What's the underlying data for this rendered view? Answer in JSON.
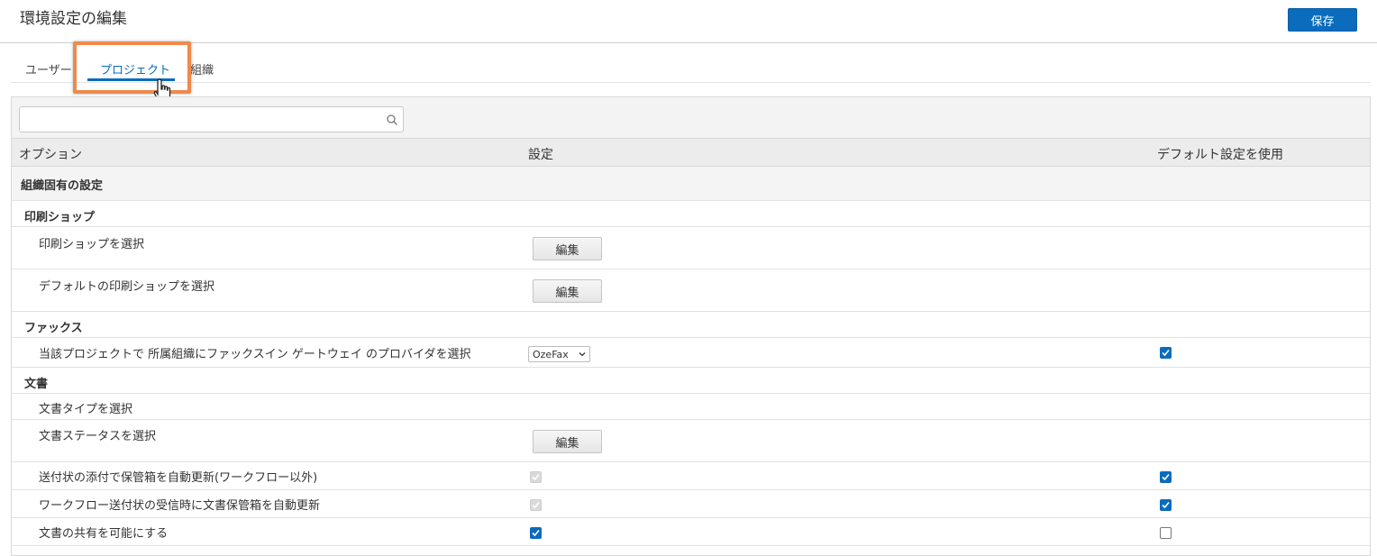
{
  "header": {
    "title": "環境設定の編集",
    "save_label": "保存"
  },
  "tabs": [
    {
      "label": "ユーザー",
      "active": false
    },
    {
      "label": "プロジェクト",
      "active": true
    },
    {
      "label": "組織",
      "active": false
    }
  ],
  "search": {
    "value": "",
    "placeholder": ""
  },
  "columns": {
    "option": "オプション",
    "setting": "設定",
    "use_default": "デフォルト設定を使用"
  },
  "rows": {
    "org_specific": "組織固有の設定",
    "print_shop": "印刷ショップ",
    "select_print_shop": "印刷ショップを選択",
    "select_default_print_shop": "デフォルトの印刷ショップを選択",
    "fax": "ファックス",
    "fax_provider": "当該プロジェクトで 所属組織にファックスイン ゲートウェイ のプロバイダを選択",
    "fax_provider_value": "OzeFax",
    "documents": "文書",
    "select_doc_type": "文書タイプを選択",
    "select_doc_status": "文書ステータスを選択",
    "auto_update_transmittal": "送付状の添付で保管箱を自動更新(ワークフロー以外)",
    "auto_update_workflow": "ワークフロー送付状の受信時に文書保管箱を自動更新",
    "enable_doc_sharing": "文書の共有を可能にする"
  },
  "edit_label": "編集",
  "states": {
    "fax_use_default": true,
    "auto_update_transmittal_setting": true,
    "auto_update_transmittal_default": true,
    "auto_update_workflow_setting": true,
    "auto_update_workflow_default": true,
    "enable_doc_sharing_setting": true,
    "enable_doc_sharing_default": false
  },
  "colors": {
    "accent": "#0b6bbd",
    "highlight": "#f08a4b"
  }
}
